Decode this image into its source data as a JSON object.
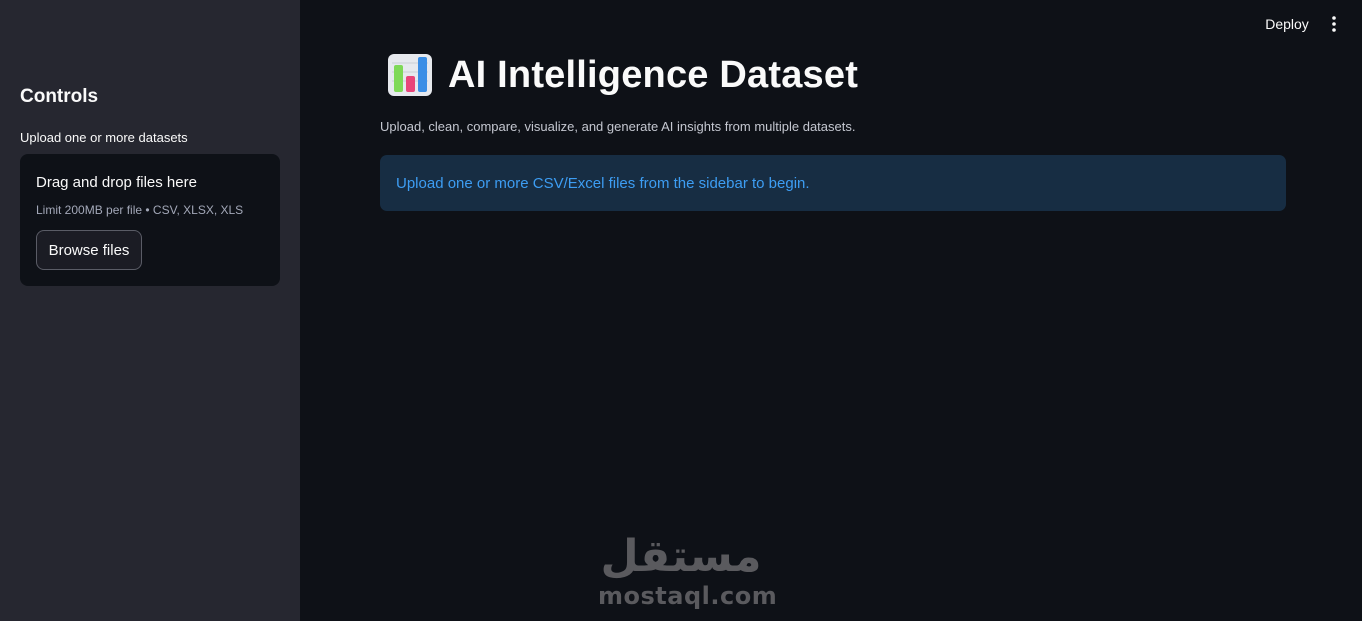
{
  "sidebar": {
    "heading": "Controls",
    "uploader": {
      "label": "Upload one or more datasets",
      "drop_text": "Drag and drop files here",
      "limit_text": "Limit 200MB per file • CSV, XLSX, XLS",
      "browse_label": "Browse files"
    }
  },
  "header": {
    "deploy_label": "Deploy",
    "menu_icon": "more-vertical-icon"
  },
  "main": {
    "title_icon": "bar-chart-emoji-icon",
    "title": "AI Intelligence Dataset",
    "subtitle": "Upload, clean, compare, visualize, and generate AI insights from multiple datasets.",
    "info_message": "Upload one or more CSV/Excel files from the sidebar to begin."
  },
  "watermark": {
    "arabic": "مستقل",
    "latin": "mostaql.com"
  },
  "colors": {
    "background": "#0e1117",
    "sidebar": "#262730",
    "info_bg": "#172d43",
    "info_text": "#3d9df3"
  }
}
